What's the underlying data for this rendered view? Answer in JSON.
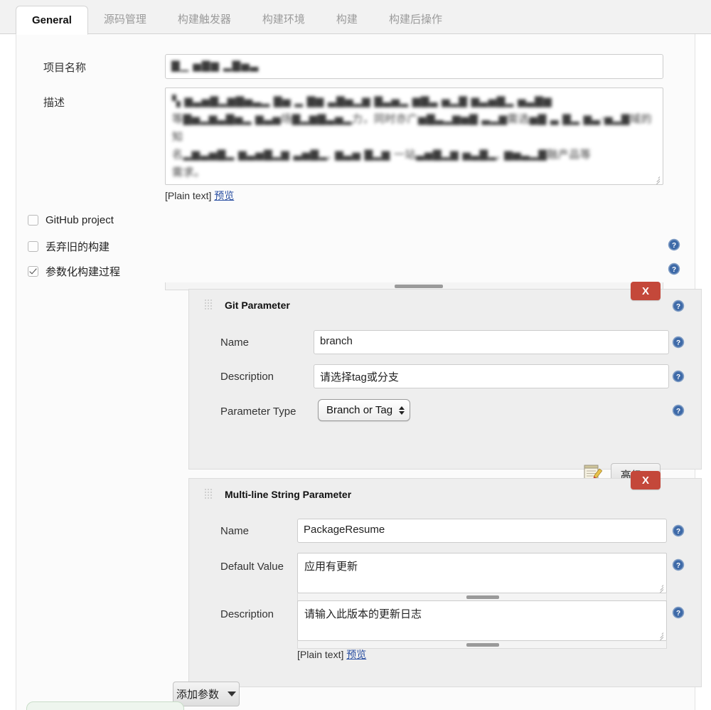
{
  "tabs": [
    {
      "label": "General",
      "active": true
    },
    {
      "label": "源码管理",
      "active": false
    },
    {
      "label": "构建触发器",
      "active": false
    },
    {
      "label": "构建环境",
      "active": false
    },
    {
      "label": "构建",
      "active": false
    },
    {
      "label": "构建后操作",
      "active": false
    }
  ],
  "general": {
    "project_name_label": "项目名称",
    "project_name_value": "▇▁ ▅▇▆ ▂▇▅▃",
    "description_label": "描述",
    "description_value": "▚ ▆▃▅▇▂▆▇▅▃▂ ▇▅ ▂ ▇▆ ▃▇▅▂▆ ▇▃▅▂ ▆▇▃ ▅▂▇ ▆▃▅▇▂ ▅▃▇▆\n等▇▅▂▆▃▇▅▂ ▆▃▅场▇▂▆▇▃▅▂力，同时亦广▅▇▃▂▆▅▇ ▃▂▆需选▅▇ ▃ ▇▂ ▆▃·▅▂▇域的知\n名▂▆▃▅▇▂ ▆▃▅▇▂▆ ▃▅▇▂, ▆▃▅ ▇▂▆ 一站▃▅▇▂▆ ▅▃▇▂, ▆▅▃▂▇融产品等\n需求。",
    "plain_text_label": "[Plain text]",
    "preview_label": "预览"
  },
  "checkboxes": [
    {
      "label": "GitHub project",
      "checked": false,
      "has_help": false
    },
    {
      "label": "丢弃旧的构建",
      "checked": false,
      "has_help": true
    },
    {
      "label": "参数化构建过程",
      "checked": true,
      "has_help": true
    }
  ],
  "params": [
    {
      "title": "Git Parameter",
      "close_label": "X",
      "fields": [
        {
          "label": "Name",
          "value": "branch",
          "type": "input"
        },
        {
          "label": "Description",
          "value": "请选择tag或分支",
          "type": "input"
        },
        {
          "label": "Parameter Type",
          "value": "Branch or Tag",
          "type": "select"
        }
      ],
      "advanced_label": "高级..."
    },
    {
      "title": "Multi-line String Parameter",
      "close_label": "X",
      "fields": [
        {
          "label": "Name",
          "value": "PackageResume",
          "type": "input"
        },
        {
          "label": "Default Value",
          "value": "应用有更新",
          "type": "textarea"
        },
        {
          "label": "Description",
          "value": "请输入此版本的更新日志",
          "type": "textarea"
        }
      ],
      "plain_text_label": "[Plain text]",
      "preview_label": "预览"
    }
  ],
  "add_param_button": "添加参数",
  "colors": {
    "delete_red": "#c4483a",
    "help_blue": "#4a72ad",
    "link_blue": "#2a4fa2"
  }
}
